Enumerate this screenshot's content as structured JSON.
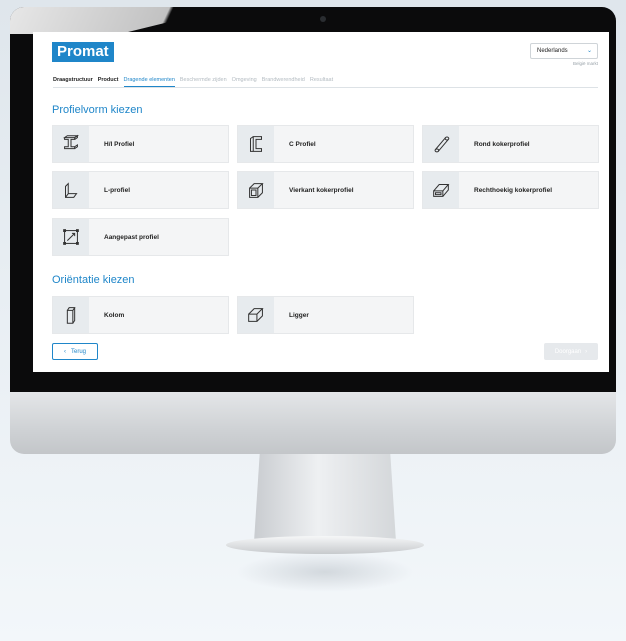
{
  "brand": {
    "logo": "Promat",
    "accent": "#1f86c9"
  },
  "header": {
    "language": "Nederlands",
    "market": "België markt"
  },
  "steps": [
    {
      "label": "Draagstructuur",
      "state": "done"
    },
    {
      "label": "Product",
      "state": "done"
    },
    {
      "label": "Dragende elementen",
      "state": "active"
    },
    {
      "label": "Beschermde zijden",
      "state": "pending"
    },
    {
      "label": "Omgeving",
      "state": "pending"
    },
    {
      "label": "Brandwerendheid",
      "state": "pending"
    },
    {
      "label": "Resultaat",
      "state": "pending"
    }
  ],
  "profile_section": {
    "title": "Profielvorm kiezen",
    "options": [
      {
        "label": "H/I Profiel",
        "icon": "h-profile-icon"
      },
      {
        "label": "C Profiel",
        "icon": "c-profile-icon"
      },
      {
        "label": "Rond kokerprofiel",
        "icon": "round-tube-icon"
      },
      {
        "label": "L-profiel",
        "icon": "l-profile-icon"
      },
      {
        "label": "Vierkant kokerprofiel",
        "icon": "square-tube-icon"
      },
      {
        "label": "Rechthoekig kokerprofiel",
        "icon": "rect-tube-icon"
      },
      {
        "label": "Aangepast profiel",
        "icon": "custom-profile-icon"
      }
    ]
  },
  "orientation_section": {
    "title": "Oriëntatie kiezen",
    "options": [
      {
        "label": "Kolom",
        "icon": "column-icon"
      },
      {
        "label": "Ligger",
        "icon": "beam-icon"
      }
    ]
  },
  "footer": {
    "back_label": "Terug",
    "next_label": "Doorgaan"
  }
}
